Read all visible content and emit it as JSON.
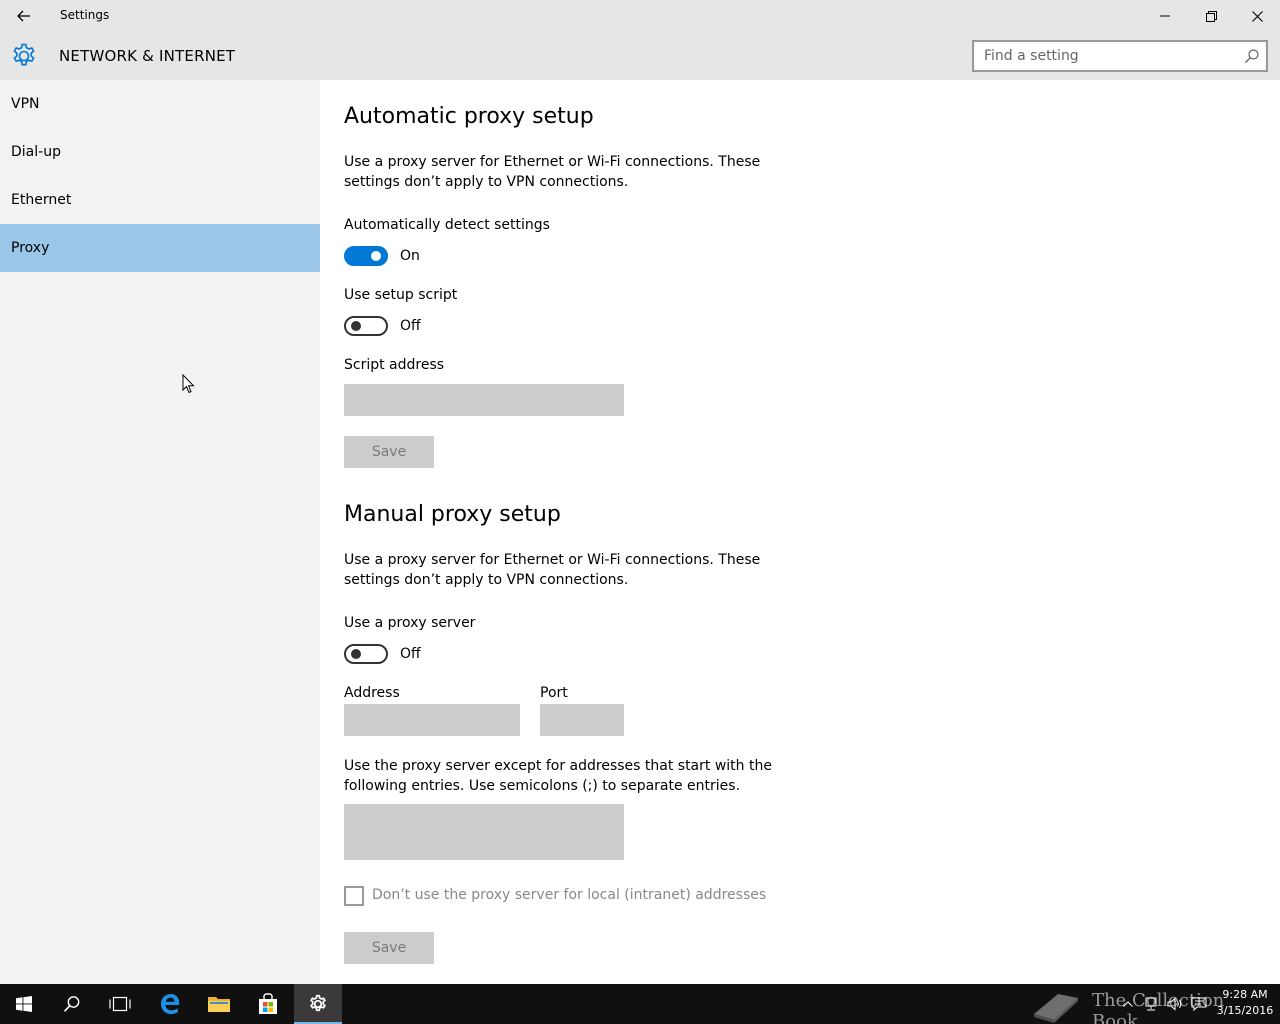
{
  "window": {
    "title": "Settings"
  },
  "header": {
    "title": "NETWORK & INTERNET",
    "search_placeholder": "Find a setting"
  },
  "sidebar": {
    "items": [
      {
        "label": "VPN",
        "selected": false
      },
      {
        "label": "Dial-up",
        "selected": false
      },
      {
        "label": "Ethernet",
        "selected": false
      },
      {
        "label": "Proxy",
        "selected": true
      }
    ]
  },
  "auto_proxy": {
    "heading": "Automatic proxy setup",
    "description": "Use a proxy server for Ethernet or Wi-Fi connections. These settings don’t apply to VPN connections.",
    "detect_label": "Automatically detect settings",
    "detect_state": "On",
    "script_label": "Use setup script",
    "script_state": "Off",
    "script_address_label": "Script address",
    "script_address_value": "",
    "save_label": "Save"
  },
  "manual_proxy": {
    "heading": "Manual proxy setup",
    "description": "Use a proxy server for Ethernet or Wi-Fi connections. These settings don’t apply to VPN connections.",
    "use_proxy_label": "Use a proxy server",
    "use_proxy_state": "Off",
    "address_label": "Address",
    "address_value": "",
    "port_label": "Port",
    "port_value": "",
    "exceptions_description": "Use the proxy server except for addresses that start with the following entries. Use semicolons (;) to separate entries.",
    "exceptions_value": "",
    "local_bypass_label": "Don’t use the proxy server for local (intranet) addresses",
    "save_label": "Save"
  },
  "taskbar": {
    "watermark": "The Collection Book",
    "time": "9:28 AM",
    "date": "3/15/2016"
  },
  "colors": {
    "accent": "#0078d7",
    "selected_nav": "#99c6e9",
    "chrome": "#e6e6e6",
    "sidebar": "#f2f2f2"
  }
}
